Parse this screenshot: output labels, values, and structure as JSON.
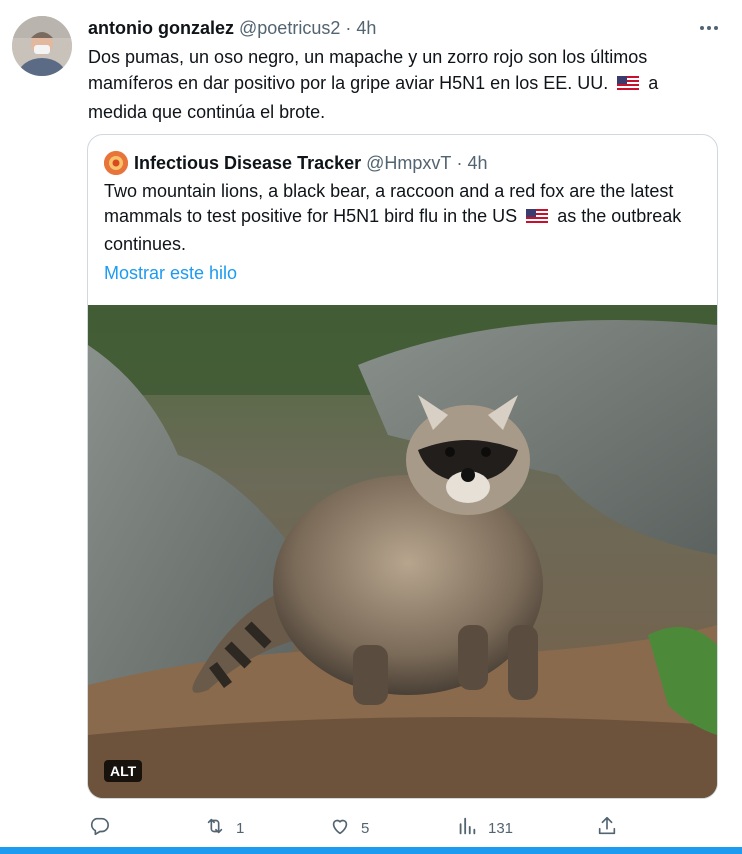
{
  "tweet": {
    "author_name": "antonio gonzalez",
    "author_handle": "@poetricus2",
    "separator": "·",
    "time": "4h",
    "text_before_flag": "Dos pumas, un oso negro, un mapache y un zorro rojo son los últimos mamíferos en dar positivo por la gripe aviar H5N1 en los EE. UU.",
    "text_after_flag": "a medida que continúa el brote."
  },
  "quote": {
    "author_name": "Infectious Disease Tracker",
    "author_handle": "@HmpxvT",
    "separator": "·",
    "time": "4h",
    "text_before_flag": "Two mountain lions, a black bear, a raccoon and a red fox are the latest mammals to test positive for H5N1 bird flu in the US",
    "text_after_flag": "as the outbreak continues.",
    "show_thread": "Mostrar este hilo",
    "alt_badge": "ALT"
  },
  "actions": {
    "reply_count": "",
    "retweet_count": "1",
    "like_count": "5",
    "views_count": "131"
  },
  "colors": {
    "link": "#1d9bf0",
    "muted": "#536471",
    "border": "#cfd9de"
  },
  "icons": [
    "more-icon",
    "reply-icon",
    "retweet-icon",
    "like-icon",
    "views-icon",
    "share-icon",
    "us-flag-icon"
  ]
}
